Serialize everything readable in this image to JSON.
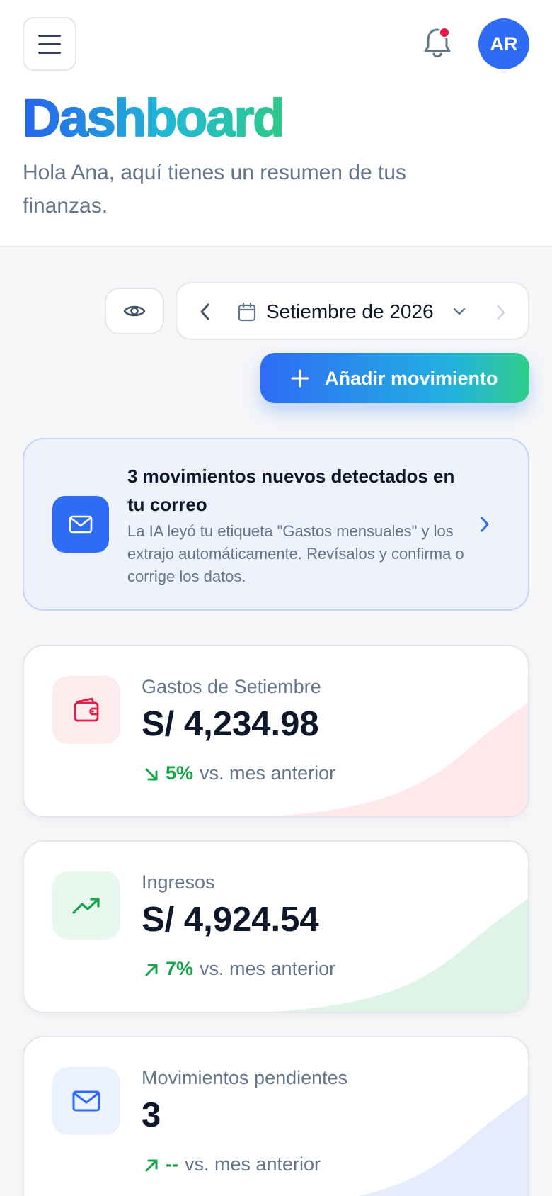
{
  "header": {
    "title": "Dashboard",
    "subtitle": "Hola Ana, aquí tienes un resumen de tus finanzas.",
    "avatar_initials": "AR",
    "has_notification": true
  },
  "toolbar": {
    "month_label": "Setiembre de 2026",
    "add_label": "Añadir movimiento"
  },
  "alert": {
    "title": "3 movimientos nuevos detectados en tu correo",
    "description": "La IA leyó tu etiqueta \"Gastos mensuales\" y los extrajo automáticamente. Revísalos y confirma o corrige los datos."
  },
  "cards": [
    {
      "label": "Gastos de Setiembre",
      "value": "S/ 4,234.98",
      "trend_direction": "down",
      "trend_pct": "5%",
      "trend_suffix": "vs. mes anterior",
      "icon": "wallet-icon",
      "accent": "#e11d48"
    },
    {
      "label": "Ingresos",
      "value": "S/ 4,924.54",
      "trend_direction": "up",
      "trend_pct": "7%",
      "trend_suffix": "vs. mes anterior",
      "icon": "trending-up-icon",
      "accent": "#16a34a"
    },
    {
      "label": "Movimientos pendientes",
      "value": "3",
      "trend_direction": "up",
      "trend_pct": "--",
      "trend_suffix": "vs. mes anterior",
      "icon": "mail-icon",
      "accent": "#2f6cf6"
    }
  ],
  "colors": {
    "primary": "#2f6cf6",
    "positive": "#16a34a",
    "negative": "#e11d48",
    "title_gradient": [
      "#2563eb",
      "#22b8d6",
      "#2fc98a"
    ]
  }
}
